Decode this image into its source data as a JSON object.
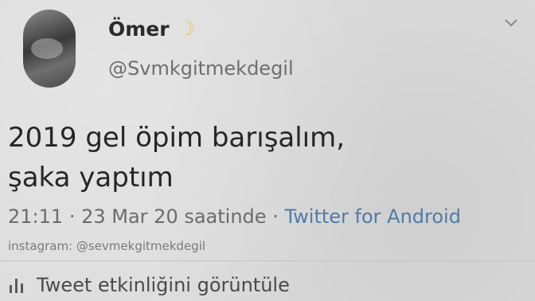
{
  "tweet": {
    "display_name": "Ömer",
    "handle": "@Svmkgitmekdegil",
    "text_line1": "2019 gel öpim barışalım,",
    "text_line2": "şaka yaptım",
    "time": "21:11",
    "separator": "·",
    "date": "23 Mar 20 saatinde",
    "source": "Twitter for Android",
    "caption": "instagram: @sevmekgitmekdegil",
    "activity_label": "Tweet etkinliğini görüntüle"
  },
  "icons": {
    "name_emoji": "moon-icon",
    "menu": "chevron-down-icon",
    "activity": "bar-chart-icon"
  },
  "colors": {
    "background": "#dcdcdc",
    "link": "#4f7ca8",
    "moon": "#e1c46a"
  }
}
